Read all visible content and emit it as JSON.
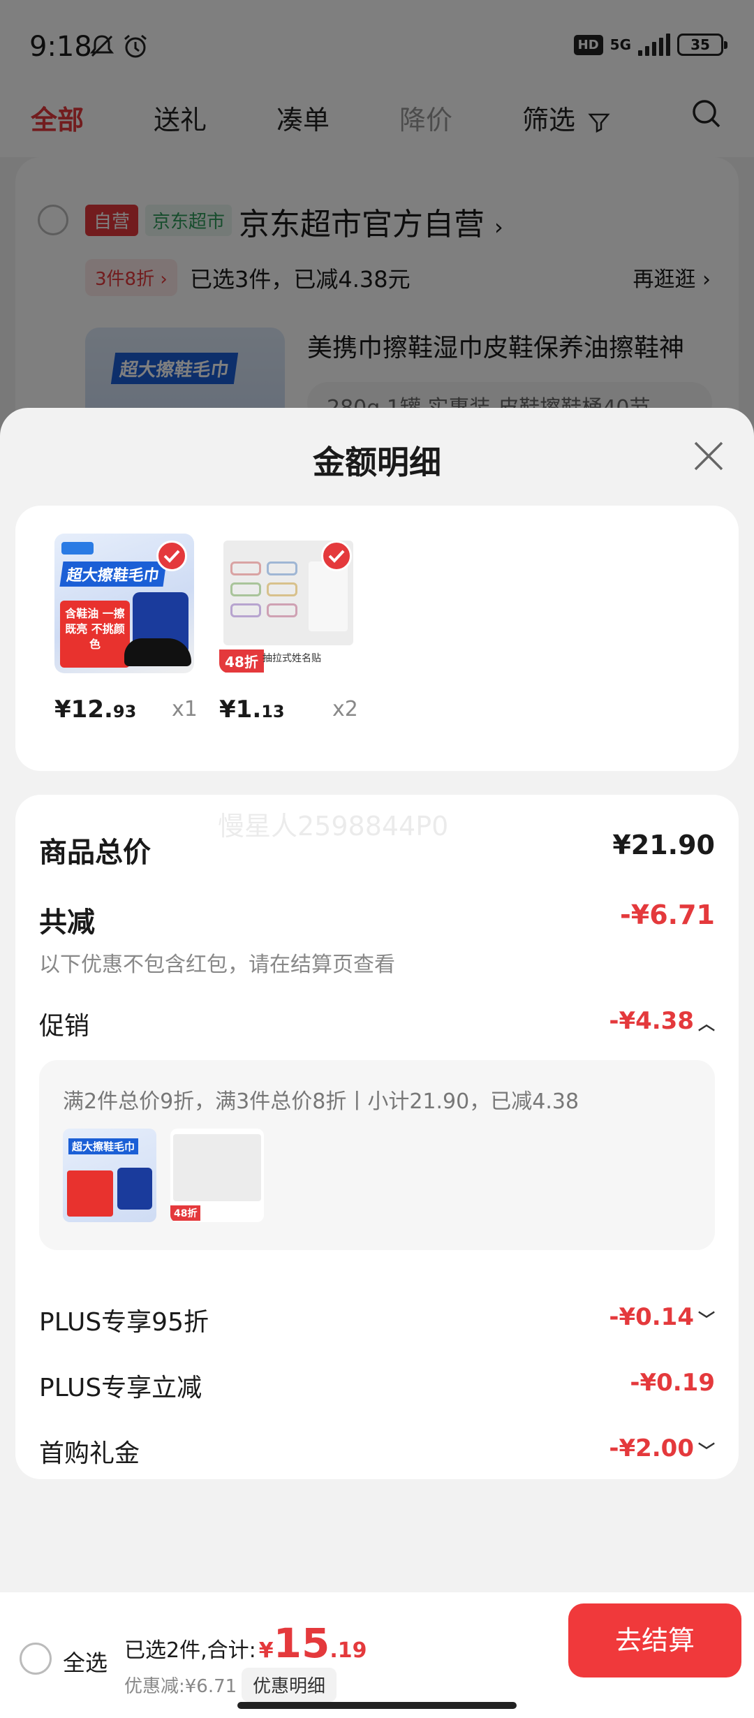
{
  "status_bar": {
    "time": "9:18",
    "hd": "HD",
    "network": "5G",
    "battery": "35"
  },
  "tabs": [
    {
      "label": "全部"
    },
    {
      "label": "送礼"
    },
    {
      "label": "凑单"
    },
    {
      "label": "降价"
    },
    {
      "label": "筛选"
    }
  ],
  "store": {
    "tag_self": "自营",
    "tag_market": "京东超市",
    "name": "京东超市官方自营",
    "name_arrow": "›",
    "promo_pill": "3件8折 ›",
    "promo_text": "已选3件，已减4.38元",
    "promo_more": "再逛逛 ›",
    "product_title": "美携巾擦鞋湿巾皮鞋保养油擦鞋神",
    "product_spec": "280g 1罐 实惠装-皮鞋擦鞋桶40节 ⌄"
  },
  "sheet": {
    "title": "金额明细",
    "items": [
      {
        "price_int": "¥12.",
        "price_dec": "93",
        "qty": "x1",
        "img_label_top": "超大擦鞋毛巾",
        "img_label": "含鞋油 一擦既亮 不挑颜色"
      },
      {
        "price_int": "¥1.",
        "price_dec": "13",
        "qty": "x2",
        "img_label_top": "抽拉式姓名贴",
        "img_label": "48折"
      }
    ],
    "total_label": "商品总价",
    "total_value": "¥21.90",
    "reduce_label": "共减",
    "reduce_value": "-¥6.71",
    "reduce_note": "以下优惠不包含红包，请在结算页查看",
    "promo_label": "促销",
    "promo_value": "-¥4.38",
    "promo_desc": "满2件总价9折，满3件总价8折丨小计21.90，已减4.38",
    "plus_discount_label": "PLUS专享95折",
    "plus_discount_value": "-¥0.14",
    "plus_instant_label": "PLUS专享立减",
    "plus_instant_value": "-¥0.19",
    "first_gift_label": "首购礼金",
    "first_gift_value": "-¥2.00",
    "watermark": "慢星人2598844P0"
  },
  "bottom_bar": {
    "select_all": "全选",
    "selected_text": "已选2件,合计:",
    "total_yen": "¥",
    "total_int": "15",
    "total_dec": ".19",
    "discount_text": "优惠减:¥6.71",
    "detail_pill": "优惠明细",
    "checkout": "去结算"
  },
  "colors": {
    "accent": "#e4393c",
    "market_green": "#2f9b5b",
    "battery": "#f6b600"
  }
}
